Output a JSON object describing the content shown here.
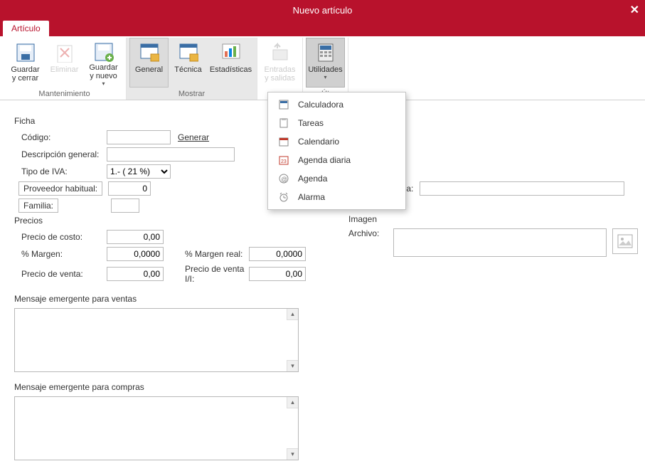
{
  "window": {
    "title": "Nuevo artículo"
  },
  "tab": {
    "label": "Artículo"
  },
  "ribbon": {
    "maintenance": {
      "group_label": "Mantenimiento",
      "save_close": "Guardar\ny cerrar",
      "delete": "Eliminar",
      "save_new": "Guardar\ny nuevo"
    },
    "show": {
      "group_label": "Mostrar",
      "general": "General",
      "technical": "Técnica",
      "stats": "Estadísticas"
    },
    "inout": {
      "group_label": "",
      "entries_exits": "Entradas\ny salidas"
    },
    "utils": {
      "group_label": "Út",
      "utilities": "Utilidades"
    }
  },
  "dropdown": {
    "items": [
      {
        "label": "Calculadora"
      },
      {
        "label": "Tareas"
      },
      {
        "label": "Calendario"
      },
      {
        "label": "Agenda diaria"
      },
      {
        "label": "Agenda"
      },
      {
        "label": "Alarma"
      }
    ]
  },
  "form": {
    "ficha": {
      "head": "Ficha",
      "codigo_label": "Código:",
      "codigo_value": "",
      "generar": "Generar",
      "desc_label": "Descripción general:",
      "desc_value": "",
      "iva_label": "Tipo de IVA:",
      "iva_value": "1.- ( 21 %)",
      "proveedor_label": "Proveedor habitual:",
      "proveedor_value": "0",
      "familia_label": "Familia:",
      "familia_value": ""
    },
    "referencia": {
      "label": "Referencia:",
      "value": ""
    },
    "precios": {
      "head": "Precios",
      "costo_label": "Precio de costo:",
      "costo_value": "0,00",
      "margen_label": "% Margen:",
      "margen_value": "0,0000",
      "margen_real_label": "% Margen real:",
      "margen_real_value": "0,0000",
      "venta_label": "Precio de venta:",
      "venta_value": "0,00",
      "venta_ii_label": "Precio de venta I/I:",
      "venta_ii_value": "0,00"
    },
    "imagen": {
      "head": "Imagen",
      "archivo_label": "Archivo:",
      "archivo_value": ""
    },
    "msg_ventas": {
      "head": "Mensaje emergente para ventas"
    },
    "msg_compras": {
      "head": "Mensaje emergente para compras"
    }
  },
  "icons": {
    "chevron_down": "▾",
    "scroll_up": "▴",
    "scroll_down": "▾"
  }
}
